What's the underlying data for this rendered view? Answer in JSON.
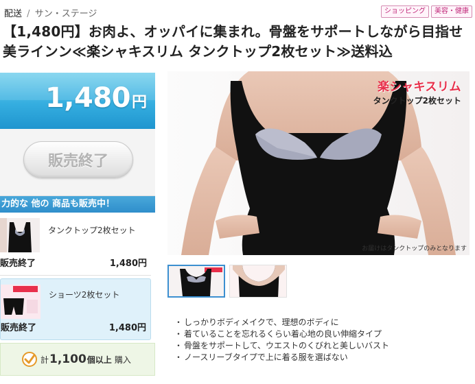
{
  "header": {
    "breadcrumb_prefix": "配送",
    "separator": "/",
    "shop": "サン・ステージ",
    "tags": [
      "ショッピング",
      "美容・健康"
    ]
  },
  "title": "【1,480円】お肉よ、オッパイに集まれ。骨盤をサポートしながら目指せ美ラインン≪楽シャキスリム タンクトップ2枚セット≫送料込",
  "price": {
    "amount": "1,480",
    "unit": "円",
    "sold_label": "販売終了"
  },
  "others": {
    "heading": "力的な 他の 商品も販売中！",
    "items": [
      {
        "name": "タンクトップ2枚セット",
        "status": "販売終了",
        "price": "1,480円"
      },
      {
        "name": "ショーツ2枚セット",
        "status": "販売終了",
        "price": "1,480円"
      }
    ]
  },
  "sold_count": {
    "prefix": "計",
    "count": "1,100",
    "unit": "個以上",
    "label": "購入"
  },
  "main_image": {
    "brand": "楽シャキスリム",
    "product": "タンクトップ2枚セット",
    "note": "お届けはタンクトップのみとなります"
  },
  "features": [
    "しっかりボディメイクで、理想のボディに",
    "着ていることを忘れるくらい着心地の良い伸縮タイプ",
    "骨盤をサポートして、ウエストのくびれと美しいバスト",
    "ノースリーブタイプで上に着る服を選ばない"
  ],
  "colors": {
    "accent_blue": "#35aee0",
    "brand_red": "#e8304b",
    "tag_pink": "#c0297a"
  },
  "icons": [
    "check-icon"
  ]
}
